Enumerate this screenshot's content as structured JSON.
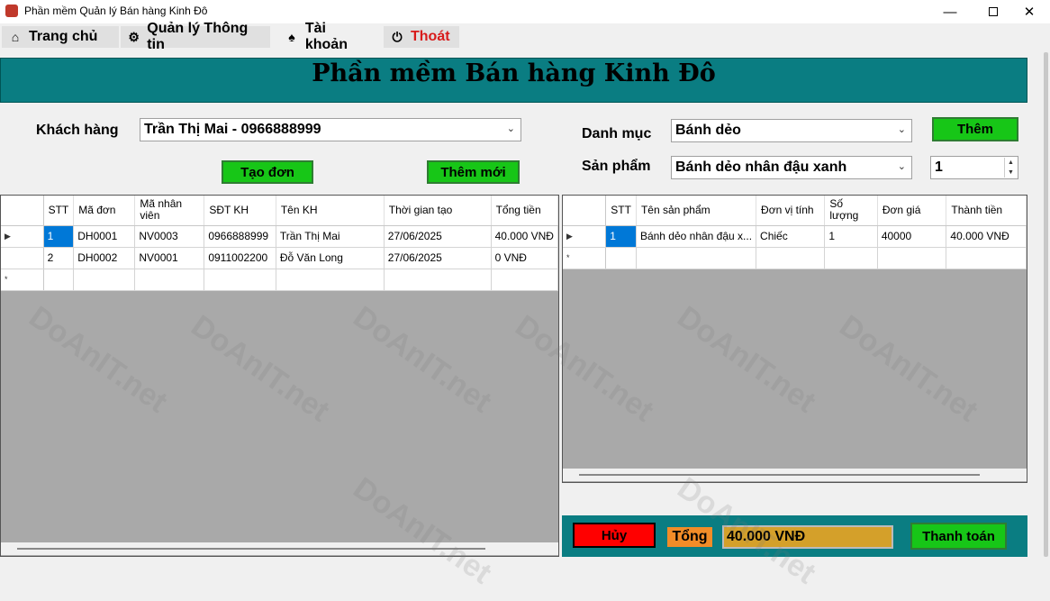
{
  "window": {
    "title": "Phần mềm Quản lý Bán hàng Kinh Đô"
  },
  "menu": {
    "items": [
      {
        "label": "Trang chủ",
        "icon": "home-icon"
      },
      {
        "label": "Quản lý Thông tin",
        "icon": "settings-icon"
      },
      {
        "label": "Tài khoản",
        "icon": "user-icon"
      },
      {
        "label": "Thoát",
        "icon": "power-icon"
      }
    ]
  },
  "header": {
    "title": "Phần mềm Bán hàng Kinh Đô"
  },
  "customer": {
    "label": "Khách hàng",
    "value": "Trần Thị Mai - 0966888999"
  },
  "buttons": {
    "create_order": "Tạo đơn",
    "new": "Thêm mới",
    "add": "Thêm",
    "cancel": "Hủy",
    "pay": "Thanh toán"
  },
  "category": {
    "label": "Danh mục",
    "value": "Bánh dẻo"
  },
  "product": {
    "label": "Sản phẩm",
    "value": "Bánh dẻo nhân đậu xanh"
  },
  "quantity": "1",
  "orders_grid": {
    "columns": [
      "STT",
      "Mã đơn",
      "Mã nhân viên",
      "SĐT KH",
      "Tên KH",
      "Thời gian tạo",
      "Tổng tiền"
    ],
    "rows": [
      [
        "1",
        "DH0001",
        "NV0003",
        "0966888999",
        "Trần Thị Mai",
        "27/06/2025",
        "40.000 VNĐ"
      ],
      [
        "2",
        "DH0002",
        "NV0001",
        "0911002200",
        "Đỗ Văn Long",
        "27/06/2025",
        "0 VNĐ"
      ]
    ]
  },
  "items_grid": {
    "columns": [
      "STT",
      "Tên sản phẩm",
      "Đơn vị tính",
      "Số lượng",
      "Đơn giá",
      "Thành tiền"
    ],
    "rows": [
      [
        "1",
        "Bánh dẻo nhân đậu x...",
        "Chiếc",
        "1",
        "40000",
        "40.000 VNĐ"
      ]
    ]
  },
  "total": {
    "label": "Tổng",
    "value": "40.000 VNĐ"
  },
  "watermark": "DoAnIT.net",
  "colors": {
    "teal": "#0a7d82",
    "green": "#17c617",
    "red": "#ff0000",
    "orange": "#f28c28",
    "gold": "#d4a02a"
  }
}
